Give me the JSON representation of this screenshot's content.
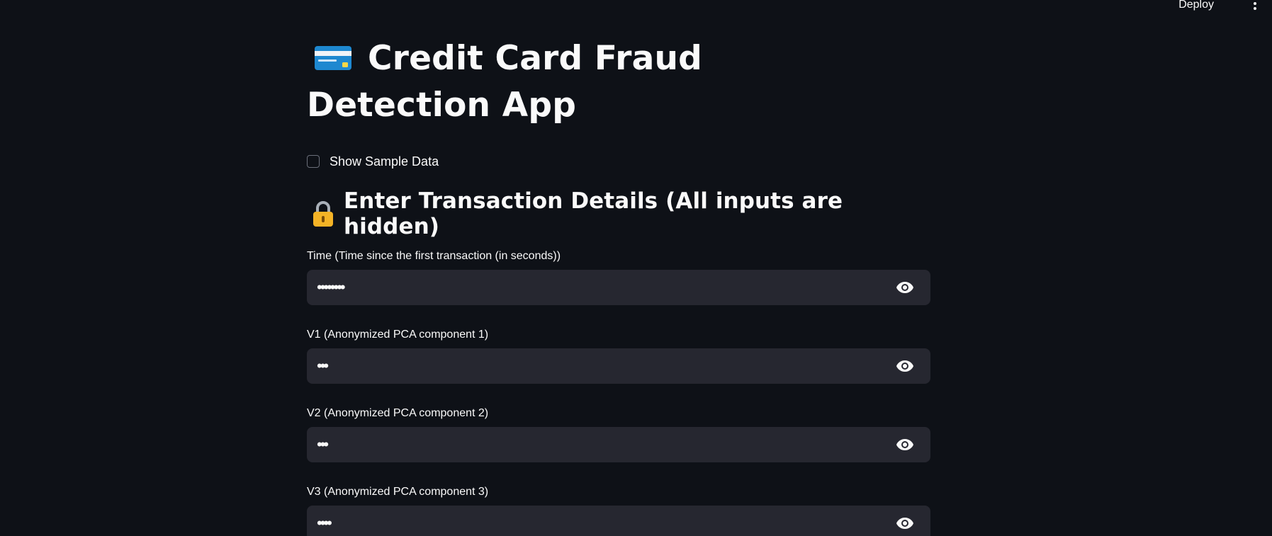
{
  "header": {
    "deploy_label": "Deploy",
    "menu_icon": "kebab-menu-icon"
  },
  "main": {
    "title": "Credit Card Fraud Detection App",
    "title_icon": "credit-card-icon",
    "sample_checkbox": {
      "label": "Show Sample Data",
      "checked": false
    },
    "subheader": {
      "icon": "lock-icon",
      "text": "Enter Transaction Details (All inputs are hidden)"
    },
    "fields": [
      {
        "label": "Time (Time since the first transaction (in seconds))",
        "value": "••••••••"
      },
      {
        "label": "V1 (Anonymized PCA component 1)",
        "value": "•••"
      },
      {
        "label": "V2 (Anonymized PCA component 2)",
        "value": "•••"
      },
      {
        "label": "V3 (Anonymized PCA component 3)",
        "value": "••••"
      }
    ]
  },
  "colors": {
    "background": "#0e1117",
    "input_background": "#262730",
    "text": "#fafafa"
  }
}
